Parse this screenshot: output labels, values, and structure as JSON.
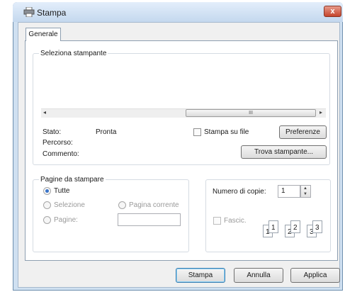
{
  "window": {
    "title": "Stampa",
    "close_label": "x"
  },
  "tabs": [
    {
      "label": "Generale"
    }
  ],
  "select_printer": {
    "legend": "Seleziona stampante",
    "scroll_thumb": "III",
    "status_label": "Stato:",
    "status_value": "Pronta",
    "path_label": "Percorso:",
    "comment_label": "Commento:",
    "print_to_file_label": "Stampa su file",
    "print_to_file_checked": false,
    "preferences_label": "Preferenze",
    "find_printer_label": "Trova stampante..."
  },
  "page_range": {
    "legend": "Pagine da stampare",
    "all_label": "Tutte",
    "selection_label": "Selezione",
    "current_page_label": "Pagina corrente",
    "pages_label": "Pagine:",
    "pages_value": "",
    "selected": "all"
  },
  "copies": {
    "copies_label": "Numero di copie:",
    "copies_value": "1",
    "collate_label": "Fascic.",
    "collate_checked": false,
    "collate_page_labels": [
      "1",
      "1",
      "2",
      "2",
      "3",
      "3"
    ]
  },
  "footer": {
    "print_label": "Stampa",
    "cancel_label": "Annulla",
    "apply_label": "Applica"
  },
  "colors": {
    "accent": "#3a74c9",
    "window_frame": "#cfe0f1",
    "close": "#c5452c"
  },
  "icons": [
    "printer-icon",
    "close-icon",
    "scroll-left-icon",
    "scroll-right-icon",
    "spin-up-icon",
    "spin-down-icon"
  ]
}
